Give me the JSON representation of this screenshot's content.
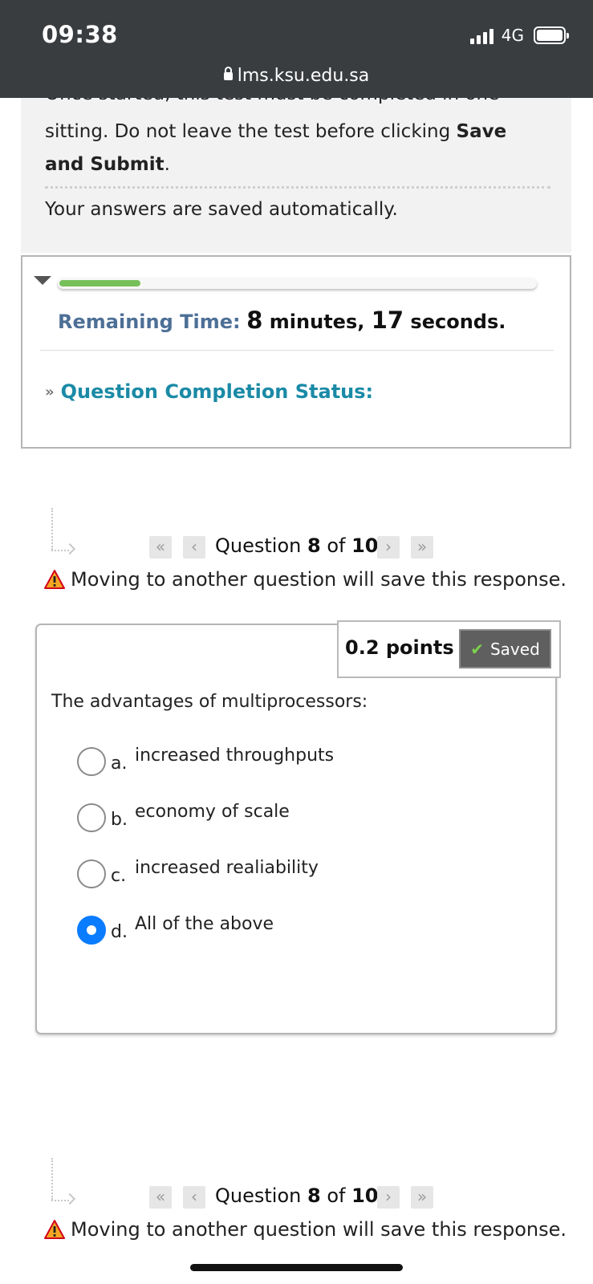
{
  "status_bar": {
    "time": "09:38",
    "network": "4G",
    "url": "lms.ksu.edu.sa"
  },
  "instructions": {
    "clipped_line": "Once started, this test must be completed in one",
    "line1_prefix": "sitting. Do not leave the test before clicking ",
    "line1_bold": "Save and Submit",
    "line1_suffix": ".",
    "autosave": "Your answers are saved automatically."
  },
  "timer": {
    "progress_fraction": 0.17,
    "label": "Remaining Time:",
    "minutes": "8",
    "minutes_word": " minutes, ",
    "seconds": "17",
    "seconds_word": " seconds.",
    "completion_status": "Question Completion Status:"
  },
  "navigation": {
    "question_word": "Question ",
    "current": "8",
    "of_word": " of ",
    "total": "10",
    "warning": "Moving to another question will save this response.",
    "first_icon": "double-chevron-left-icon",
    "prev_icon": "chevron-left-icon",
    "next_icon": "chevron-right-icon",
    "last_icon": "double-chevron-right-icon"
  },
  "question": {
    "points": "0.2 points",
    "saved_label": "Saved",
    "text": "The advantages of multiprocessors:",
    "options": [
      {
        "letter": "a.",
        "text": "increased throughputs",
        "selected": false
      },
      {
        "letter": "b.",
        "text": "economy of scale",
        "selected": false
      },
      {
        "letter": "c.",
        "text": "increased realiability",
        "selected": false
      },
      {
        "letter": "d.",
        "text": "All of the above",
        "selected": true
      }
    ]
  },
  "colors": {
    "status_bar_bg": "#3a3d40",
    "remaining_label": "#4d6f96",
    "completion_status": "#1a8aa6",
    "progress_fill": "#76c05a",
    "radio_selected": "#0a7cff",
    "saved_bg": "#5f5f5f"
  }
}
